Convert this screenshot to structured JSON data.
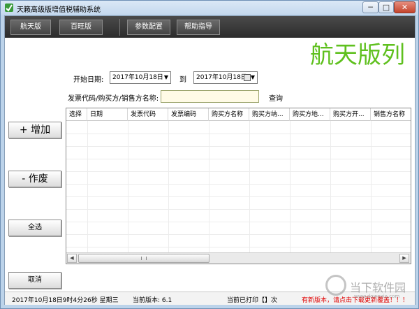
{
  "window": {
    "title": "天籁高级版增值税辅助系统",
    "minimize": "─",
    "maximize": "□",
    "close": "✕"
  },
  "navbar": {
    "tabs": [
      "航天版",
      "百旺版",
      "参数配置",
      "帮助指导"
    ]
  },
  "brand": "航天版列",
  "filters": {
    "start_label": "开始日期:",
    "start_date": "2017年10月18日",
    "to_label": "到",
    "end_date": "2017年10月18日",
    "search_label": "发票代码/购买方/销售方名称:",
    "search_value": "",
    "query_button": "查询"
  },
  "sidebar": {
    "add": "+ 增加",
    "void": "- 作废",
    "select_all": "全选",
    "cancel": "取消"
  },
  "table": {
    "columns": [
      "选择",
      "日期",
      "发票代码",
      "发票编码",
      "购买方名称",
      "购买方纳...",
      "购买方地...",
      "购买方开...",
      "销售方名称"
    ],
    "rows": []
  },
  "status": {
    "datetime": "2017年10月18日9时4分26秒 星期三",
    "version": "当前版本: 6.1",
    "printed": "当前已打印【】次",
    "alert": "有新版本，请点击下载更新覆盖！！！"
  },
  "watermark": {
    "text": "当下软件园",
    "url": "www.downxia.com"
  },
  "colors": {
    "brand": "#5fc01e",
    "navbar": "#3a3a3a",
    "alert": "#e00000"
  }
}
